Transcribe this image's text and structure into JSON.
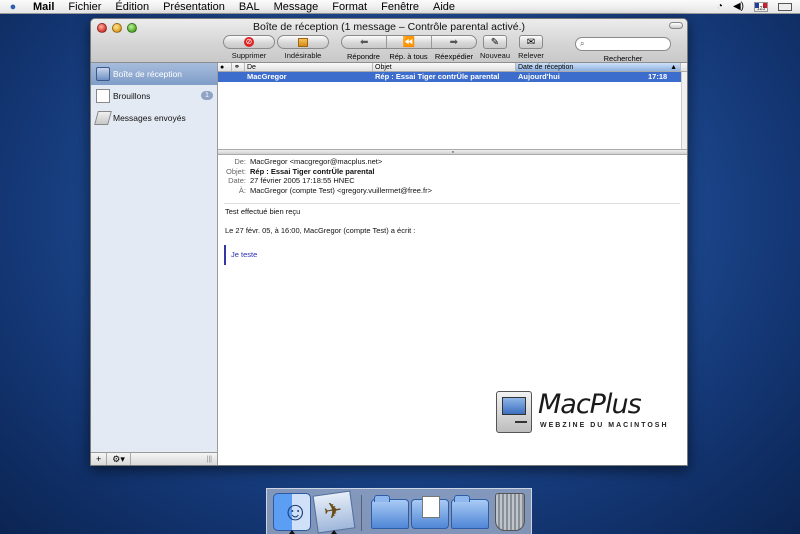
{
  "menubar": {
    "items": [
      "Mail",
      "Fichier",
      "Édition",
      "Présentation",
      "BAL",
      "Message",
      "Format",
      "Fenêtre",
      "Aide"
    ],
    "keyboard_layout": "123"
  },
  "window": {
    "title": "Boîte de réception (1 message – Contrôle parental activé.)"
  },
  "toolbar": {
    "delete_label": "Supprimer",
    "junk_label": "Indésirable",
    "reply_label": "Répondre",
    "reply_all_label": "Rép. à tous",
    "forward_label": "Réexpédier",
    "new_label": "Nouveau",
    "get_mail_label": "Relever",
    "search_label": "Rechercher",
    "search_placeholder": ""
  },
  "sidebar": {
    "items": [
      {
        "label": "Boîte de réception",
        "icon": "inbox-icon",
        "selected": true
      },
      {
        "label": "Brouillons",
        "icon": "drafts-icon",
        "badge": "1"
      },
      {
        "label": "Messages envoyés",
        "icon": "sent-icon"
      }
    ],
    "bottom": {
      "add": "+",
      "action": "⚙▾"
    }
  },
  "list": {
    "columns": [
      "De",
      "Objet",
      "Date de réception"
    ],
    "rows": [
      {
        "from": "MacGregor",
        "subject": "Rép : Essai Tiger contrÜle parental",
        "date": "Aujourd'hui",
        "time": "17:18"
      }
    ]
  },
  "message": {
    "from_key": "De:",
    "from": "MacGregor <macgregor@macplus.net>",
    "subject_key": "Objet:",
    "subject": "Rép : Essai Tiger contrÜle parental",
    "date_key": "Date:",
    "date": "27 février 2005 17:18:55 HNEC",
    "to_key": "À:",
    "to": "MacGregor (compte Test) <gregory.vuillermet@free.fr>",
    "body_line1": "Test effectué bien reçu",
    "body_line2": "Le 27 févr. 05, à 16:00, MacGregor (compte Test) a écrit :",
    "quote": "Je teste"
  },
  "watermark": {
    "name": "MacPlus",
    "tagline": "WEBZINE DU MACINTOSH"
  },
  "colors": {
    "selection": "#3d6dcc",
    "quote_bar": "#3535a5",
    "desktop": "#1f4d96"
  }
}
